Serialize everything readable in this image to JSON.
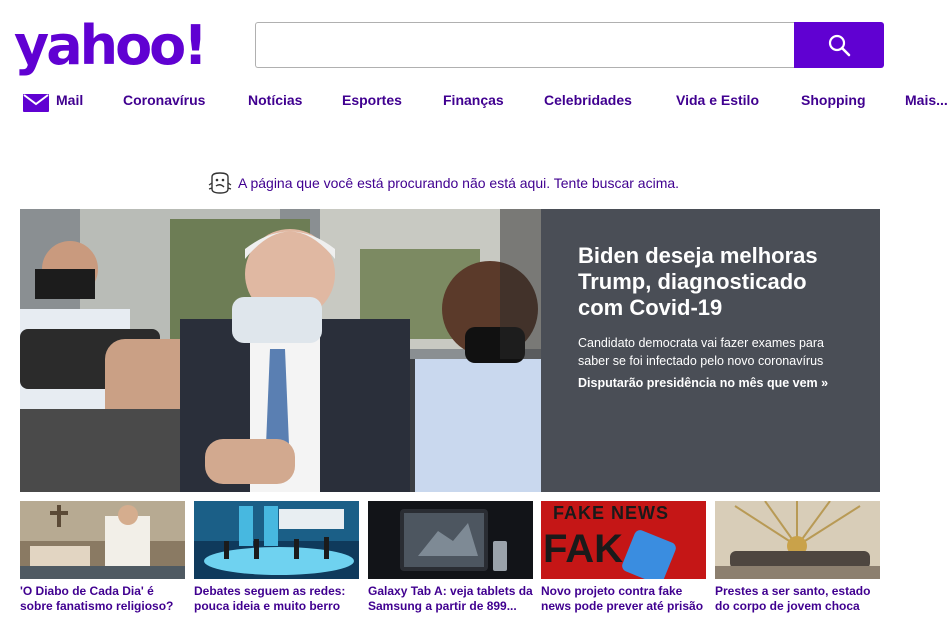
{
  "brand": {
    "logo_text": "yahoo!",
    "color": "#6001d2"
  },
  "search": {
    "placeholder": "",
    "value": "",
    "icon": "search-icon"
  },
  "nav": {
    "mail": "Mail",
    "items": [
      "Coronavírus",
      "Notícias",
      "Esportes",
      "Finanças",
      "Celebridades",
      "Vida e Estilo",
      "Shopping",
      "Mais..."
    ]
  },
  "error": {
    "message": "A página que você está procurando não está aqui. Tente buscar acima."
  },
  "hero": {
    "title": "Biden deseja melhoras Trump, diagnosticado com Covid-19",
    "summary": "Candidato democrata vai fazer exames para saber se foi infectado pelo novo coronavírus",
    "link": "Disputarão presidência no mês que vem »"
  },
  "tiles": [
    {
      "caption": "'O Diabo de Cada Dia' é sobre fanatismo religioso?"
    },
    {
      "caption": "Debates seguem as redes: pouca ideia e muito berro"
    },
    {
      "caption": "Galaxy Tab A: veja tablets da Samsung a partir de 899..."
    },
    {
      "caption": "Novo projeto contra fake news pode prever até prisão",
      "image_text": [
        "FAKE NEWS",
        "FAK"
      ]
    },
    {
      "caption": "Prestes a ser santo, estado do corpo de jovem choca"
    }
  ]
}
